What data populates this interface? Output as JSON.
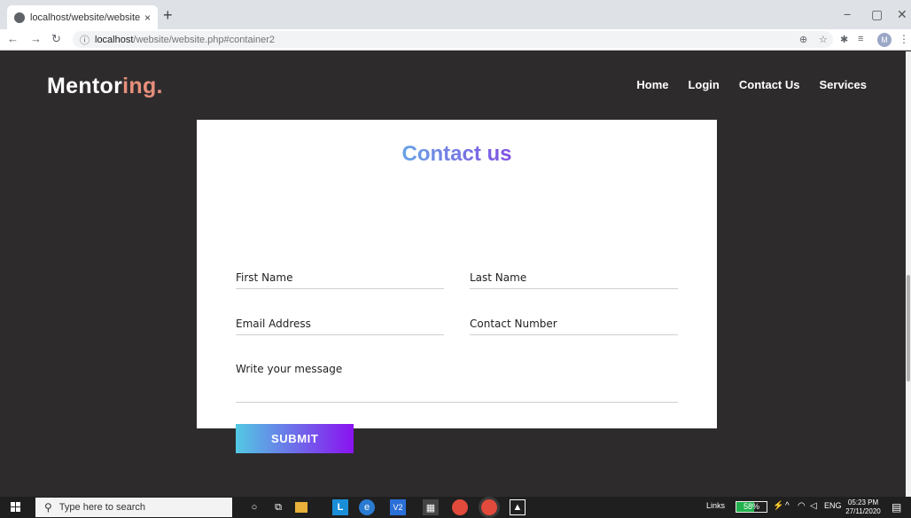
{
  "browser": {
    "tab_title": "localhost/website/website.php#c",
    "tab_close": "×",
    "new_tab": "+",
    "url_host": "localhost",
    "url_path": "/website/website.php#container2",
    "profile_initial": "M",
    "window_minimize": "−",
    "window_maximize": "▢",
    "window_close": "✕",
    "back_icon": "arrow-left",
    "forward_icon": "arrow-right",
    "reload_icon": "reload"
  },
  "site": {
    "logo_main": "Mentor",
    "logo_accent": "ing.",
    "logo_accent_color": "#e7907b",
    "nav": [
      "Home",
      "Login",
      "Contact Us",
      "Services"
    ],
    "background_color": "#2e2b2d"
  },
  "contact": {
    "title": "Contact us",
    "title_gradient": [
      "#5ec8e6",
      "#8a2be2"
    ],
    "first_name_placeholder": "First Name",
    "last_name_placeholder": "Last Name",
    "email_placeholder": "Email Address",
    "phone_placeholder": "Contact Number",
    "message_placeholder": "Write your message",
    "submit_label": "SUBMIT",
    "submit_gradient": [
      "#52c9e3",
      "#8a12f0"
    ]
  },
  "taskbar": {
    "search_placeholder": "Type here to search",
    "links_label": "Links",
    "battery_percent": 58,
    "battery_label": "58%",
    "language": "ENG",
    "time": "05:23 PM",
    "date": "27/11/2020"
  }
}
